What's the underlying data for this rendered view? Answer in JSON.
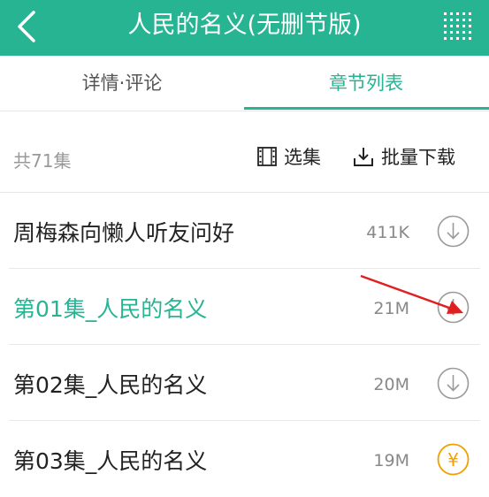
{
  "header": {
    "title": "人民的名义(无删节版)",
    "back_icon": "chevron-left-icon",
    "menu_icon": "grid-menu-icon",
    "bg_color": "#26b493"
  },
  "tabs": [
    {
      "label": "详情·评论",
      "active": false
    },
    {
      "label": "章节列表",
      "active": true
    }
  ],
  "toolbar": {
    "total": "共71集",
    "select_label": "选集",
    "batch_label": "批量下载"
  },
  "episodes": [
    {
      "name": "周梅森向懒人听友问好",
      "size": "411K",
      "action": "download-icon",
      "active": false
    },
    {
      "name": "第01集_人民的名义",
      "size": "21M",
      "action": "download-icon",
      "active": true
    },
    {
      "name": "第02集_人民的名义",
      "size": "20M",
      "action": "download-icon",
      "active": false
    },
    {
      "name": "第03集_人民的名义",
      "size": "19M",
      "action": "yen-icon",
      "active": false
    }
  ],
  "colors": {
    "accent": "#26b493",
    "annotation_arrow": "#e02020",
    "yen": "#f0a000"
  }
}
